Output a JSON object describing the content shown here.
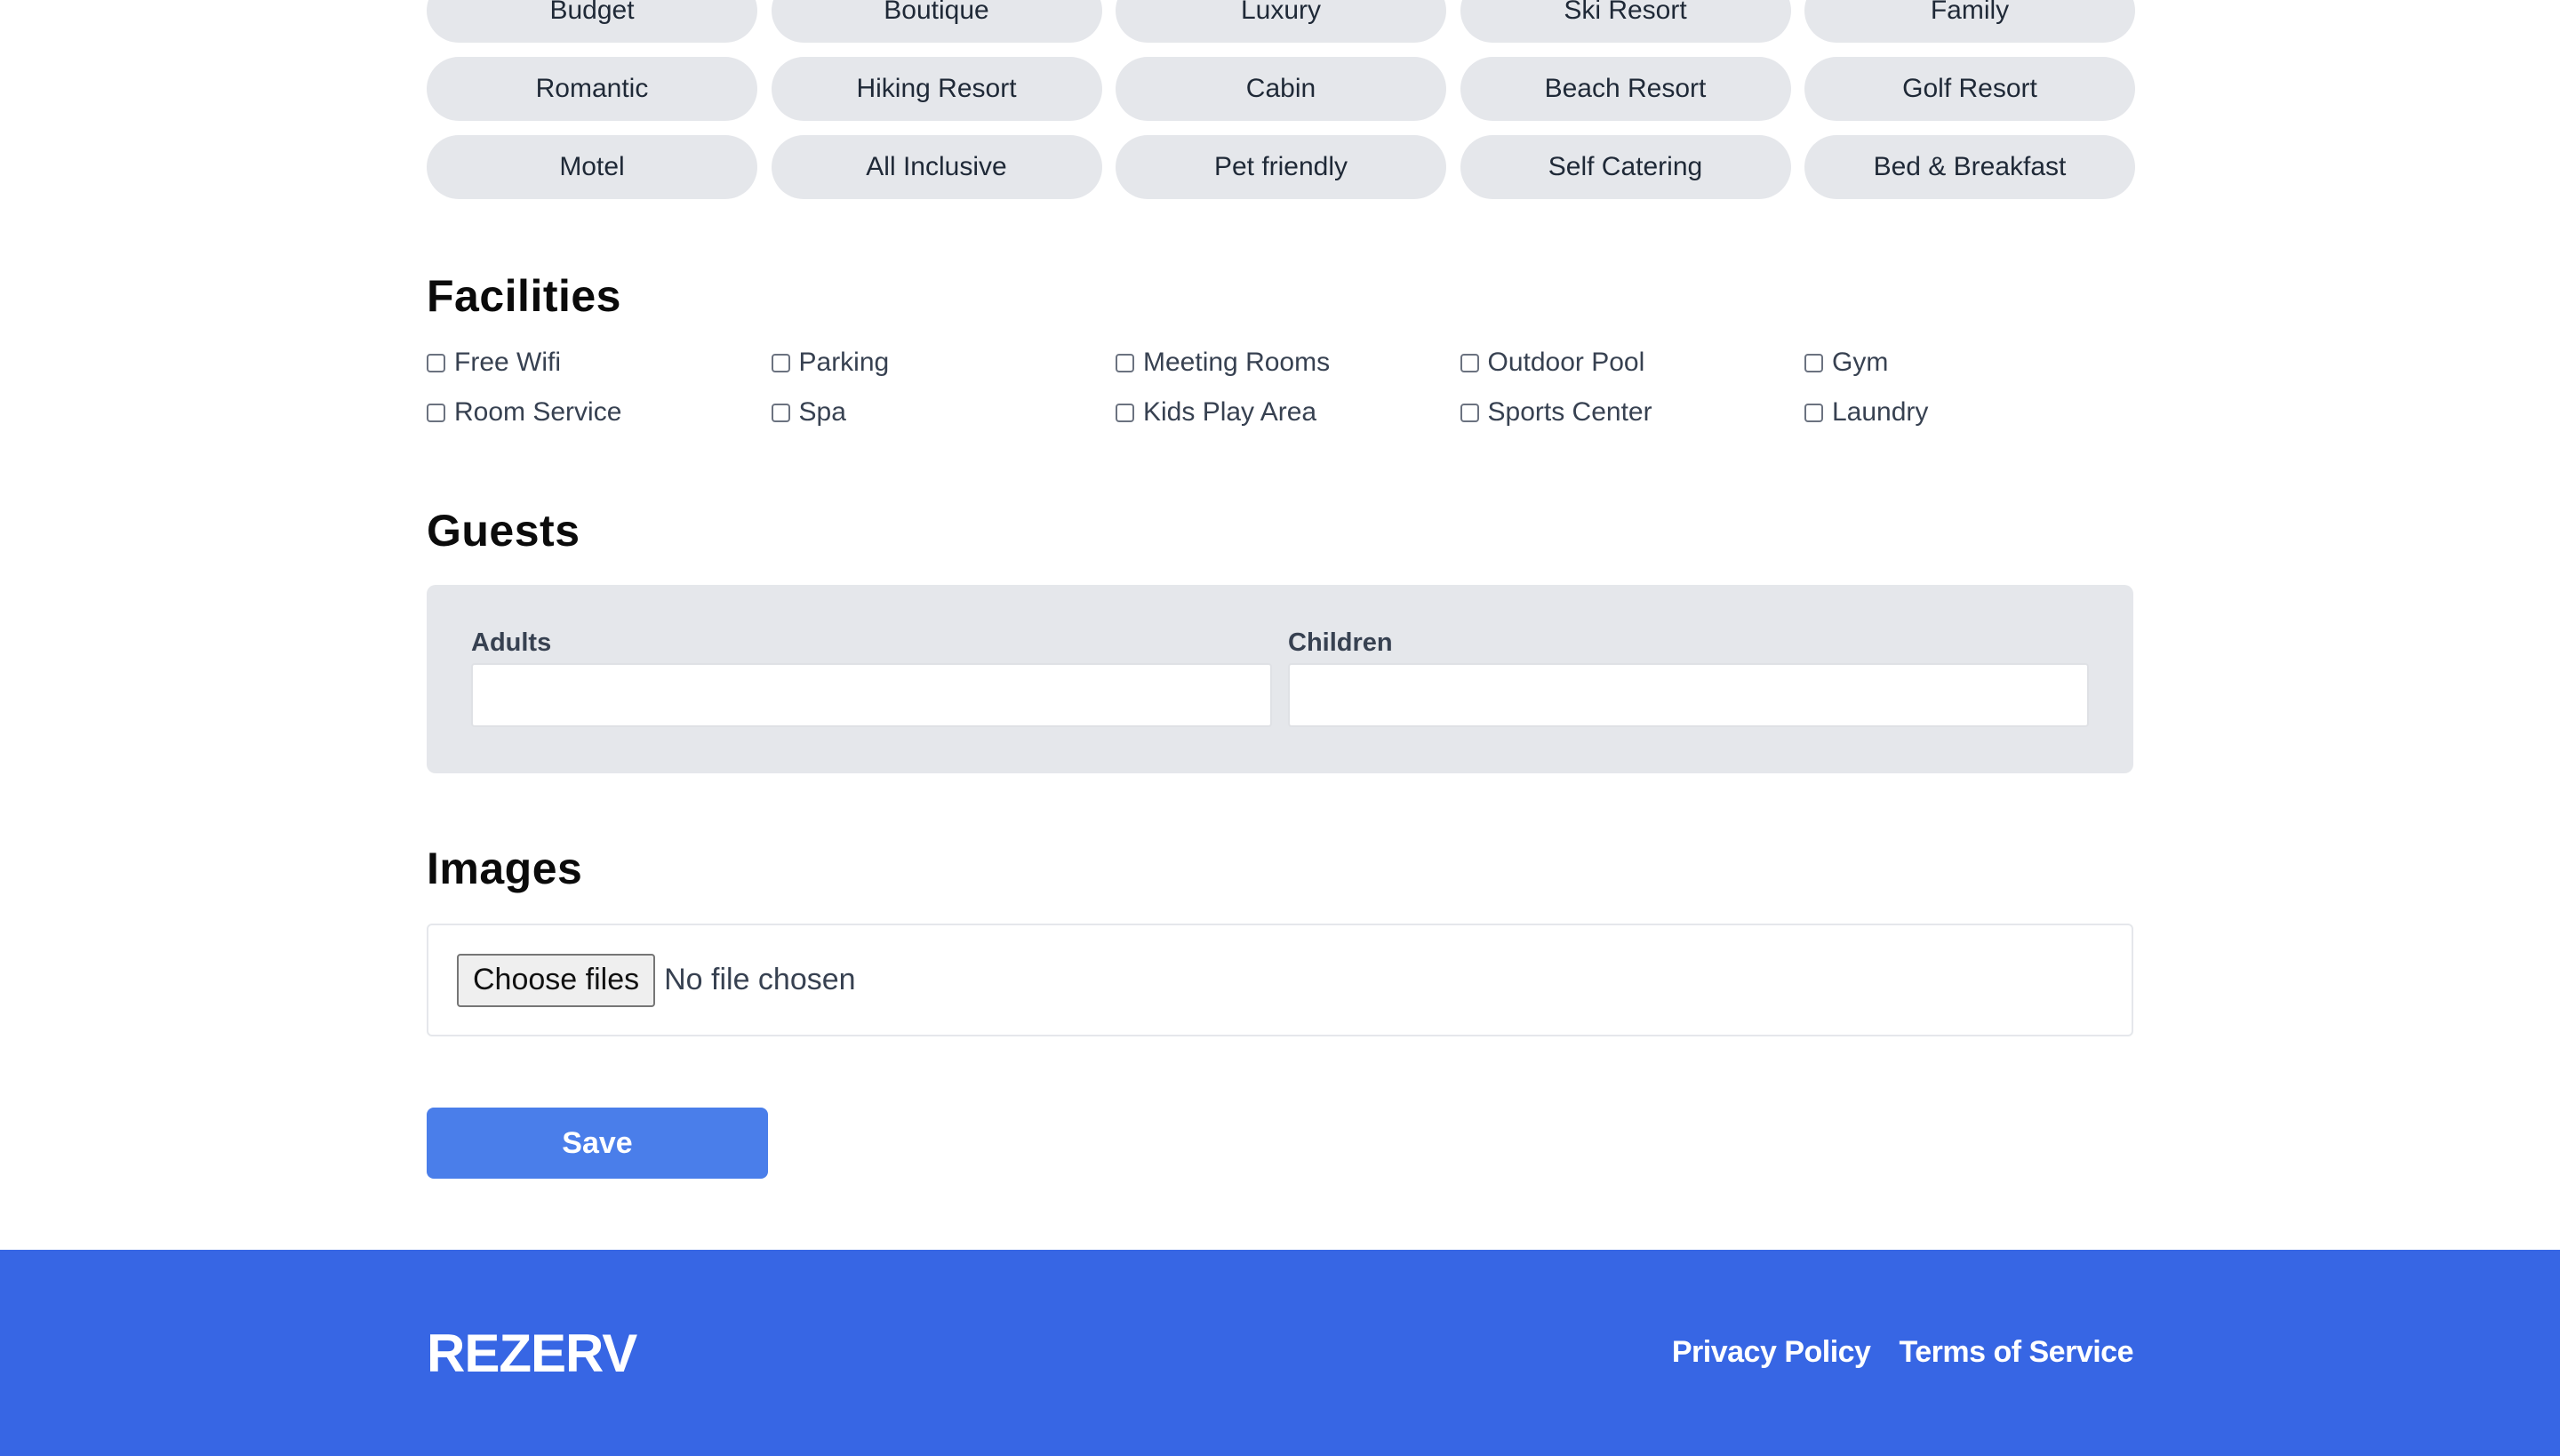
{
  "hotel_types": [
    "Budget",
    "Boutique",
    "Luxury",
    "Ski Resort",
    "Family",
    "Romantic",
    "Hiking Resort",
    "Cabin",
    "Beach Resort",
    "Golf Resort",
    "Motel",
    "All Inclusive",
    "Pet friendly",
    "Self Catering",
    "Bed & Breakfast"
  ],
  "facilities": {
    "title": "Facilities",
    "items": [
      "Free Wifi",
      "Parking",
      "Meeting Rooms",
      "Outdoor Pool",
      "Gym",
      "Room Service",
      "Spa",
      "Kids Play Area",
      "Sports Center",
      "Laundry"
    ]
  },
  "guests": {
    "title": "Guests",
    "adults_label": "Adults",
    "adults_value": "",
    "children_label": "Children",
    "children_value": ""
  },
  "images": {
    "title": "Images",
    "button_label": "Choose files",
    "status": "No file chosen"
  },
  "save_label": "Save",
  "footer": {
    "brand": "REZERV",
    "links": [
      "Privacy Policy",
      "Terms of Service"
    ]
  }
}
